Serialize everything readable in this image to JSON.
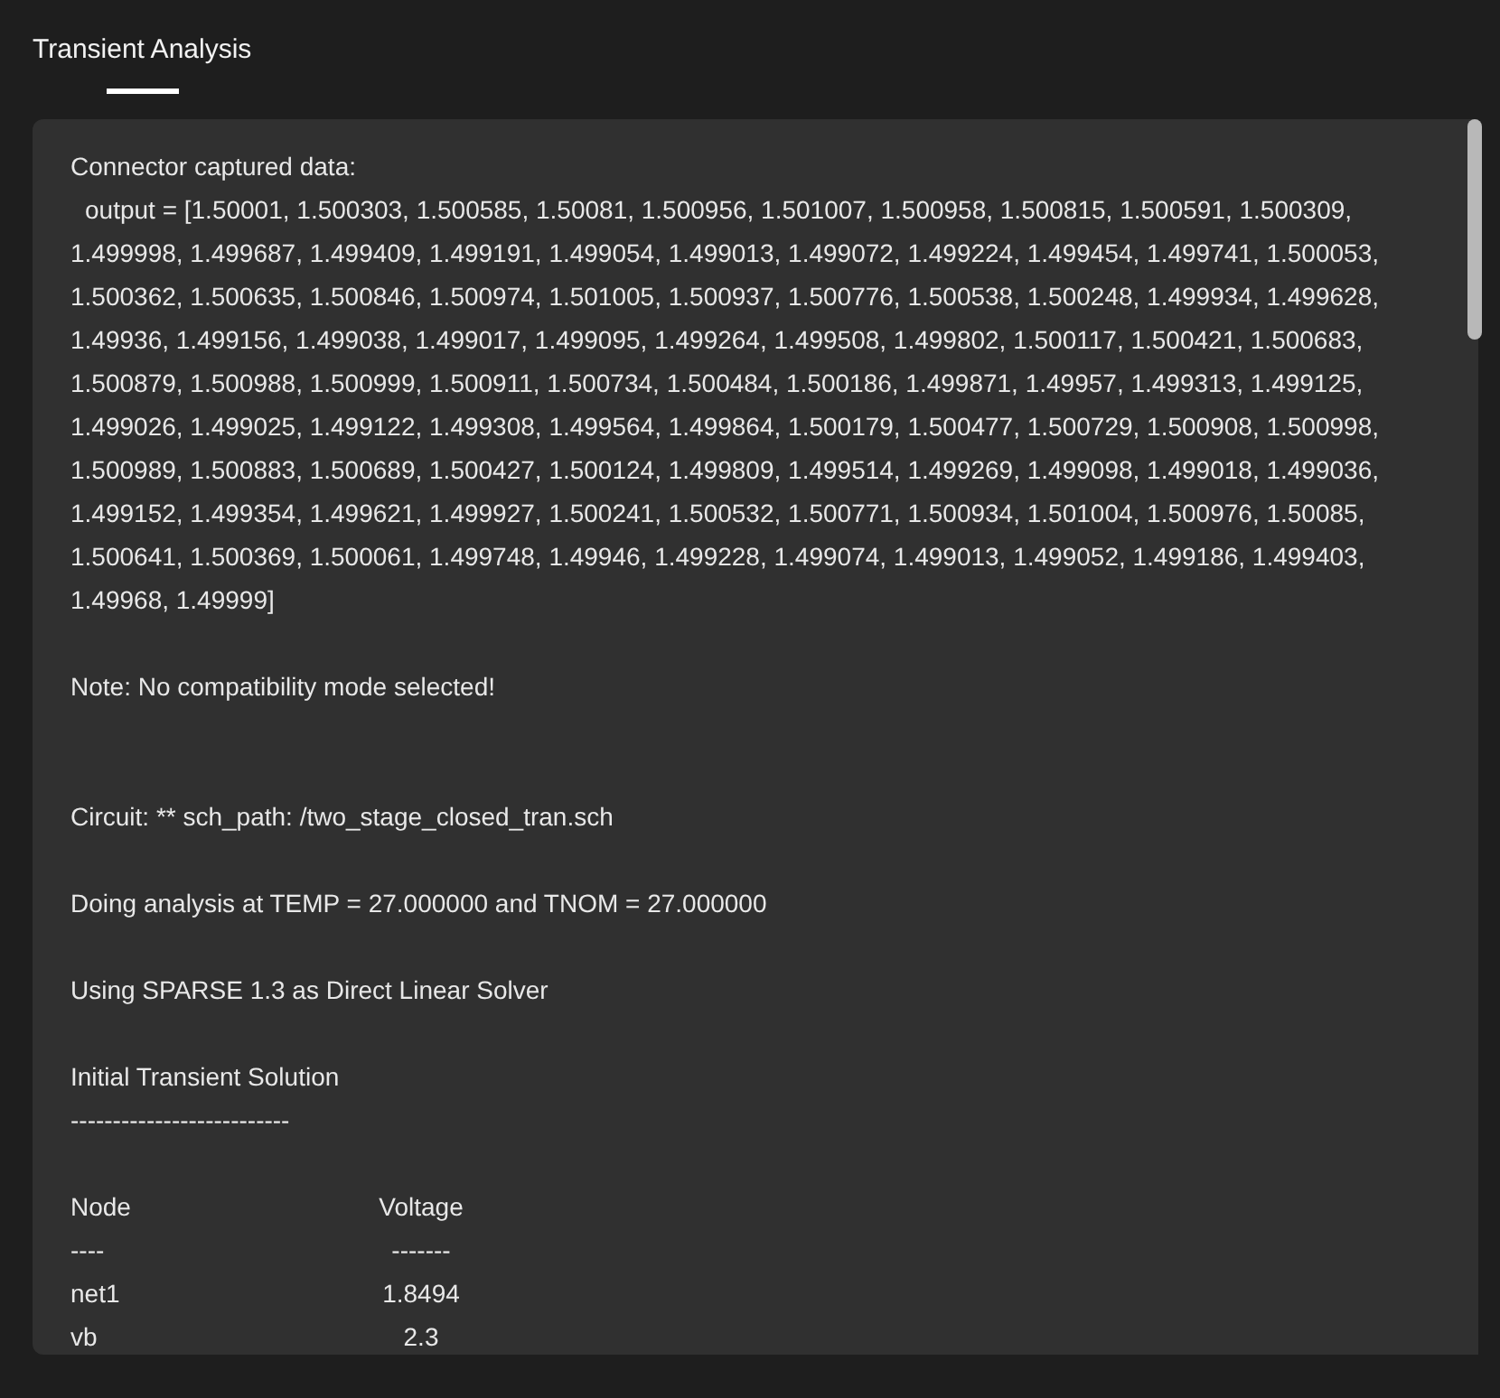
{
  "tabs": [
    {
      "label": "Transient Analysis",
      "selected": true
    }
  ],
  "log": [
    {
      "kind": "text",
      "text": "Connector captured data:"
    },
    {
      "kind": "indented",
      "text": "output = [1.50001, 1.500303, 1.500585, 1.50081, 1.500956, 1.501007, 1.500958, 1.500815, 1.500591, 1.500309, 1.499998, 1.499687, 1.499409, 1.499191, 1.499054, 1.499013, 1.499072, 1.499224, 1.499454, 1.499741, 1.500053, 1.500362, 1.500635, 1.500846, 1.500974, 1.501005, 1.500937, 1.500776, 1.500538, 1.500248, 1.499934, 1.499628, 1.49936, 1.499156, 1.499038, 1.499017, 1.499095, 1.499264, 1.499508, 1.499802, 1.500117, 1.500421, 1.500683, 1.500879, 1.500988, 1.500999, 1.500911, 1.500734, 1.500484, 1.500186, 1.499871, 1.49957, 1.499313, 1.499125, 1.499026, 1.499025, 1.499122, 1.499308, 1.499564, 1.499864, 1.500179, 1.500477, 1.500729, 1.500908, 1.500998, 1.500989, 1.500883, 1.500689, 1.500427, 1.500124, 1.499809, 1.499514, 1.499269, 1.499098, 1.499018, 1.499036, 1.499152, 1.499354, 1.499621, 1.499927, 1.500241, 1.500532, 1.500771, 1.500934, 1.501004, 1.500976, 1.50085, 1.500641, 1.500369, 1.500061, 1.499748, 1.49946, 1.499228, 1.499074, 1.499013, 1.499052, 1.499186, 1.499403, 1.49968, 1.49999]"
    },
    {
      "kind": "blank"
    },
    {
      "kind": "text",
      "text": "Note: No compatibility mode selected!"
    },
    {
      "kind": "blank"
    },
    {
      "kind": "blank"
    },
    {
      "kind": "text",
      "text": "Circuit: ** sch_path: /two_stage_closed_tran.sch"
    },
    {
      "kind": "blank"
    },
    {
      "kind": "text",
      "text": "Doing analysis at TEMP = 27.000000 and TNOM = 27.000000"
    },
    {
      "kind": "blank"
    },
    {
      "kind": "text",
      "text": "Using SPARSE 1.3 as Direct Linear Solver"
    },
    {
      "kind": "blank"
    },
    {
      "kind": "text",
      "text": "Initial Transient Solution"
    },
    {
      "kind": "text",
      "text": "--------------------------"
    },
    {
      "kind": "blank"
    },
    {
      "kind": "row",
      "cells": [
        "Node",
        "Voltage"
      ]
    },
    {
      "kind": "row",
      "cells": [
        "----",
        "-------"
      ]
    },
    {
      "kind": "row",
      "cells": [
        "net1",
        "1.8494"
      ]
    },
    {
      "kind": "row",
      "cells": [
        "vb",
        "2.3"
      ]
    }
  ]
}
